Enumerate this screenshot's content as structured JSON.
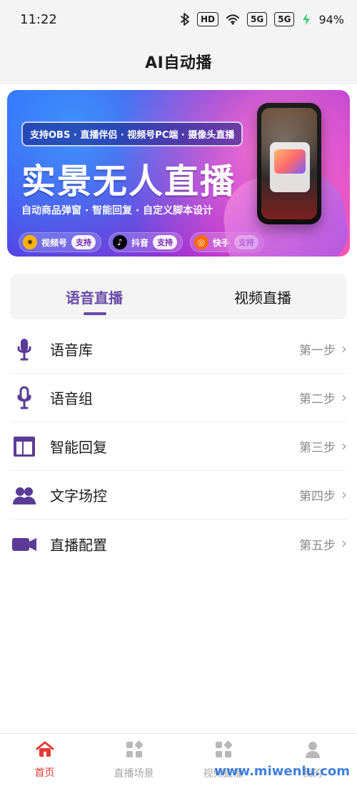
{
  "status_bar": {
    "time": "11:22",
    "bluetooth_icon": "bluetooth-icon",
    "hd_label": "HD",
    "wifi_icon": "wifi-icon",
    "signal1_label": "5G",
    "signal2_label": "5G",
    "battery_percent": "94%"
  },
  "header": {
    "title": "AI自动播"
  },
  "banner": {
    "pill_text": "支持OBS · 直播伴侣 · 视频号PC端 · 摄像头直播",
    "title": "实景无人直播",
    "subtitle": "自动商品弹窗 · 智能回复 · 自定义脚本设计",
    "supports": [
      {
        "name": "视频号",
        "tag": "支持",
        "logo_color": "#ffb300",
        "logo_glyph": "✷"
      },
      {
        "name": "抖音",
        "tag": "支持",
        "logo_color": "#000000",
        "logo_glyph": "♪"
      },
      {
        "name": "快手",
        "tag": "支持",
        "logo_color": "#ff6a00",
        "logo_glyph": "◎"
      }
    ]
  },
  "tabs": {
    "voice": "语音直播",
    "video": "视频直播",
    "active": "voice"
  },
  "menu": {
    "items": [
      {
        "label": "语音库",
        "step": "第一步",
        "icon": "microphone-filled-icon"
      },
      {
        "label": "语音组",
        "step": "第二步",
        "icon": "microphone-outline-icon"
      },
      {
        "label": "智能回复",
        "step": "第三步",
        "icon": "layout-panels-icon"
      },
      {
        "label": "文字场控",
        "step": "第四步",
        "icon": "users-icon"
      },
      {
        "label": "直播配置",
        "step": "第五步",
        "icon": "video-camera-icon"
      }
    ]
  },
  "bottom_nav": {
    "items": [
      {
        "label": "首页",
        "icon": "home-icon",
        "active": true
      },
      {
        "label": "直播场景",
        "icon": "grid-icon",
        "active": false
      },
      {
        "label": "视频直播",
        "icon": "grid-icon",
        "active": false
      },
      {
        "label": "我的",
        "icon": "user-icon",
        "active": false
      }
    ],
    "watermark": "www.miwenlu.com"
  },
  "colors": {
    "accent_purple": "#5b3b96",
    "accent_red": "#e53935"
  }
}
